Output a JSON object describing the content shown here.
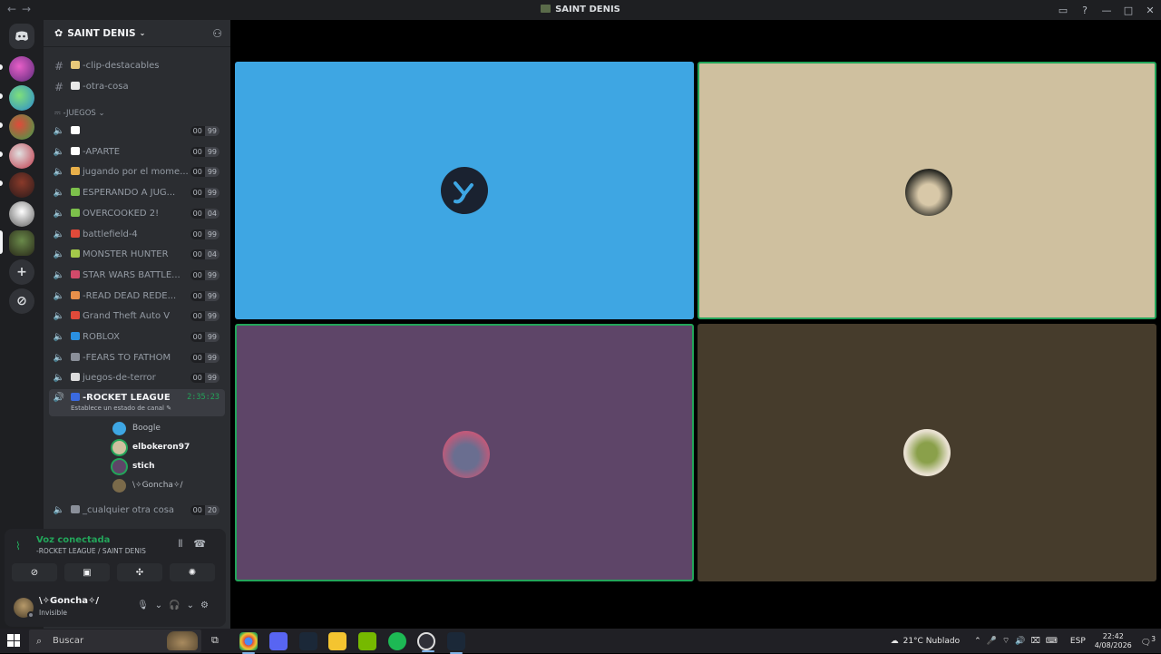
{
  "window": {
    "title": "SAINT DENIS",
    "controls": [
      "▭",
      "?",
      "—",
      "□",
      "✕"
    ]
  },
  "server": {
    "name": "SAINT DENIS",
    "category": "JUEGOS"
  },
  "text_channels": [
    {
      "name": "-clip-destacables"
    },
    {
      "name": "-otra-cosa"
    }
  ],
  "voice_channels": [
    {
      "name": "",
      "users": "00",
      "limit": "99",
      "emoji_color": "#ffffff"
    },
    {
      "name": "-APARTE",
      "users": "00",
      "limit": "99",
      "emoji_color": "#ffffff"
    },
    {
      "name": "jugando por el mome...",
      "users": "00",
      "limit": "99",
      "emoji_color": "#e8b04a"
    },
    {
      "name": "ESPERANDO A JUG...",
      "users": "00",
      "limit": "99",
      "emoji_color": "#7cc04b"
    },
    {
      "name": "OVERCOOKED 2!",
      "users": "00",
      "limit": "04",
      "emoji_color": "#7cc04b"
    },
    {
      "name": "battlefield-4",
      "users": "00",
      "limit": "99",
      "emoji_color": "#e04a3a"
    },
    {
      "name": "MONSTER HUNTER",
      "users": "00",
      "limit": "04",
      "emoji_color": "#a3c94a"
    },
    {
      "name": "STAR WARS BATTLE...",
      "users": "00",
      "limit": "99",
      "emoji_color": "#d24a6a"
    },
    {
      "name": "-READ DEAD REDE...",
      "users": "00",
      "limit": "99",
      "emoji_color": "#e8904a"
    },
    {
      "name": "Grand Theft Auto V",
      "users": "00",
      "limit": "99",
      "emoji_color": "#e04a3a"
    },
    {
      "name": "ROBLOX",
      "users": "00",
      "limit": "99",
      "emoji_color": "#2a8fe0"
    },
    {
      "name": "-FEARS TO FATHOM",
      "users": "00",
      "limit": "99",
      "emoji_color": "#8a8f99"
    },
    {
      "name": "juegos-de-terror",
      "users": "00",
      "limit": "99",
      "emoji_color": "#dddddd"
    }
  ],
  "active_channel": {
    "name": "-ROCKET LEAGUE",
    "time": "2:35:23",
    "status": "Establece un estado de canal"
  },
  "members": [
    {
      "name": "Boogle",
      "color": "#3ea6e3"
    },
    {
      "name": "elbokeron97",
      "color": "#cfc09f"
    },
    {
      "name": "stich",
      "color": "#5e4568"
    },
    {
      "name": "\\✧Goncha✧/",
      "color": "#7a6a4a"
    }
  ],
  "after_channel": {
    "name": "_cualquier otra cosa",
    "users": "00",
    "limit": "20"
  },
  "voice_panel": {
    "title": "Voz conectada",
    "subtitle": "-ROCKET LEAGUE / SAINT DENIS"
  },
  "me": {
    "name": "\\✧Goncha✧/",
    "status": "Invisible"
  },
  "tiles": [
    {
      "user": "Boogle",
      "bg": "#3ea6e3",
      "speaking": false
    },
    {
      "user": "elbokeron97",
      "bg": "#cfc09f",
      "speaking": true
    },
    {
      "user": "stich",
      "bg": "#5e4568",
      "speaking": true
    },
    {
      "user": "\\✧Goncha✧/",
      "bg": "#463c2c",
      "speaking": false
    }
  ],
  "taskbar": {
    "search_placeholder": "Buscar",
    "weather": "21°C  Nublado",
    "lang": "ESP",
    "time": "22:42",
    "date": "4/08/2026",
    "notif": "3"
  }
}
